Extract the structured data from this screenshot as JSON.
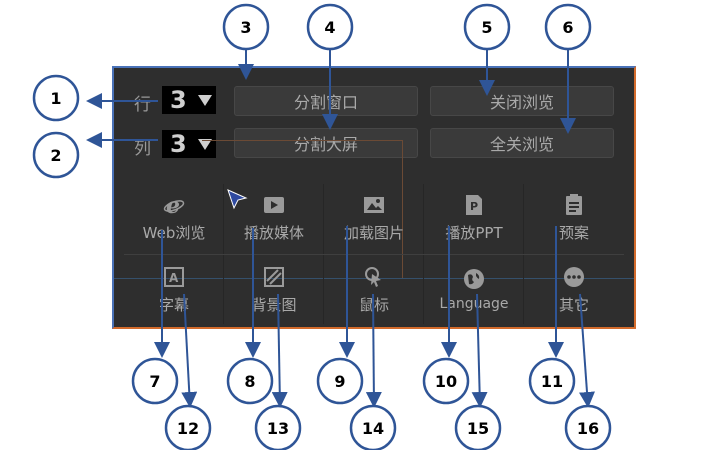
{
  "controls": {
    "rows_label": "行",
    "rows_value": "3",
    "cols_label": "列",
    "cols_value": "3",
    "split_window": "分割窗口",
    "close_browse": "关闭浏览",
    "split_screen": "分割大屏",
    "close_all_browse": "全关浏览"
  },
  "tools_row1": [
    {
      "label": "Web浏览",
      "icon": "ie-icon"
    },
    {
      "label": "播放媒体",
      "icon": "play-icon"
    },
    {
      "label": "加载图片",
      "icon": "image-icon"
    },
    {
      "label": "播放PPT",
      "icon": "ppt-icon"
    },
    {
      "label": "预案",
      "icon": "plan-icon"
    }
  ],
  "tools_row2": [
    {
      "label": "字幕",
      "icon": "subtitle-icon"
    },
    {
      "label": "背景图",
      "icon": "background-icon"
    },
    {
      "label": "鼠标",
      "icon": "mouse-icon"
    },
    {
      "label": "Language",
      "icon": "globe-icon"
    },
    {
      "label": "其它",
      "icon": "more-icon"
    }
  ],
  "callouts": [
    "1",
    "2",
    "3",
    "4",
    "5",
    "6",
    "7",
    "8",
    "9",
    "10",
    "11",
    "12",
    "13",
    "14",
    "15",
    "16"
  ],
  "colors": {
    "panel": "#2e2e2e",
    "callout_stroke": "#2f5597",
    "arrow": "#2f5597"
  }
}
